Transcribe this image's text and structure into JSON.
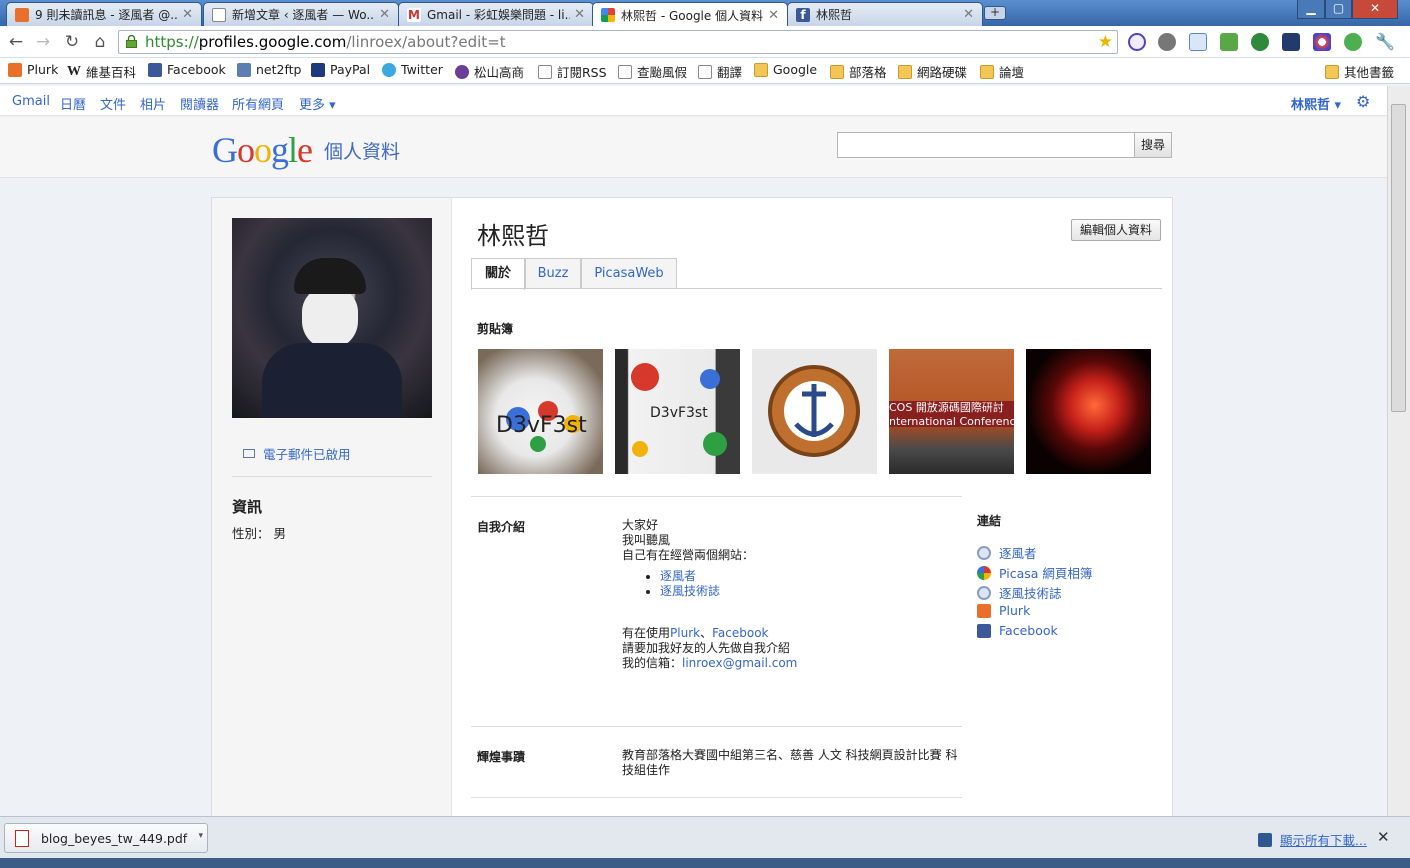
{
  "browser": {
    "tabs": [
      {
        "title": "9 則未讀訊息 - 逐風者 @...",
        "icon": "plurk-icon",
        "active": false
      },
      {
        "title": "新增文章 ‹ 逐風者 — Wo...",
        "icon": "page-icon",
        "active": false
      },
      {
        "title": "Gmail - 彩虹娛樂問題 - li...",
        "icon": "gmail-icon",
        "active": false
      },
      {
        "title": "林熙哲 - Google 個人資料",
        "icon": "google-icon",
        "active": true
      },
      {
        "title": "林熙哲",
        "icon": "facebook-icon",
        "active": false
      }
    ],
    "new_tab": "+",
    "url_scheme": "https://",
    "url_host": "profiles.google.com",
    "url_path": "/linroex/about?edit=t",
    "bookmarks": [
      {
        "label": "Plurk",
        "icon": "plurk-icon"
      },
      {
        "label": "維基百科",
        "icon": "wikipedia-icon"
      },
      {
        "label": "Facebook",
        "icon": "facebook-icon"
      },
      {
        "label": "net2ftp",
        "icon": "net2ftp-icon"
      },
      {
        "label": "PayPal",
        "icon": "paypal-icon"
      },
      {
        "label": "Twitter",
        "icon": "twitter-icon"
      },
      {
        "label": "松山高商",
        "icon": "school-icon"
      },
      {
        "label": "訂閱RSS",
        "icon": "page-icon"
      },
      {
        "label": "查颱風假",
        "icon": "page-icon"
      },
      {
        "label": "翻譯",
        "icon": "page-icon"
      },
      {
        "label": "Google",
        "icon": "folder-icon"
      },
      {
        "label": "部落格",
        "icon": "folder-icon"
      },
      {
        "label": "網路硬碟",
        "icon": "folder-icon"
      },
      {
        "label": "論壇",
        "icon": "folder-icon"
      }
    ],
    "other_bookmarks": "其他書籤"
  },
  "gbar": {
    "links": [
      "Gmail",
      "日曆",
      "文件",
      "相片",
      "閱讀器",
      "所有網頁",
      "更多 ▾"
    ],
    "user": "林熙哲 ▾"
  },
  "header": {
    "logo_text": "Google",
    "logo_suffix": "個人資料",
    "search_value": "",
    "search_button": "搜尋"
  },
  "profile": {
    "name": "林熙哲",
    "edit_button": "編輯個人資料",
    "email_status": "電子郵件已啟用",
    "info_heading": "資訊",
    "gender_label": "性別：",
    "gender_value": "男",
    "tabs": [
      "關於",
      "Buzz",
      "PicasaWeb"
    ],
    "scrapbook_heading": "剪貼簿",
    "intro_heading": "自我介紹",
    "intro_lines": [
      "大家好",
      "我叫聽風",
      "自己有在經營兩個網站："
    ],
    "intro_links": [
      "逐風者",
      "逐風技術誌"
    ],
    "using_prefix": "有在使用",
    "using_plurk": "Plurk",
    "using_sep": "、",
    "using_facebook": "Facebook",
    "friend_line": "請要加我好友的人先做自我介紹",
    "mail_prefix": "我的信箱：",
    "mail": "linroex@gmail.com",
    "achievements_heading": "輝煌事蹟",
    "achievements_text": "教育部落格大賽國中組第三名、慈善 人文 科技網頁設計比賽 科技組佳作",
    "links_heading": "連結",
    "links": [
      {
        "label": "逐風者",
        "icon": "globe-icon"
      },
      {
        "label": "Picasa 網頁相簿",
        "icon": "picasa-icon"
      },
      {
        "label": "逐風技術誌",
        "icon": "globe-icon"
      },
      {
        "label": "Plurk",
        "icon": "plurk-icon"
      },
      {
        "label": "Facebook",
        "icon": "facebook-icon"
      }
    ]
  },
  "downloads": {
    "file": "blog_beyes_tw_449.pdf",
    "show_all": "顯示所有下載..."
  }
}
